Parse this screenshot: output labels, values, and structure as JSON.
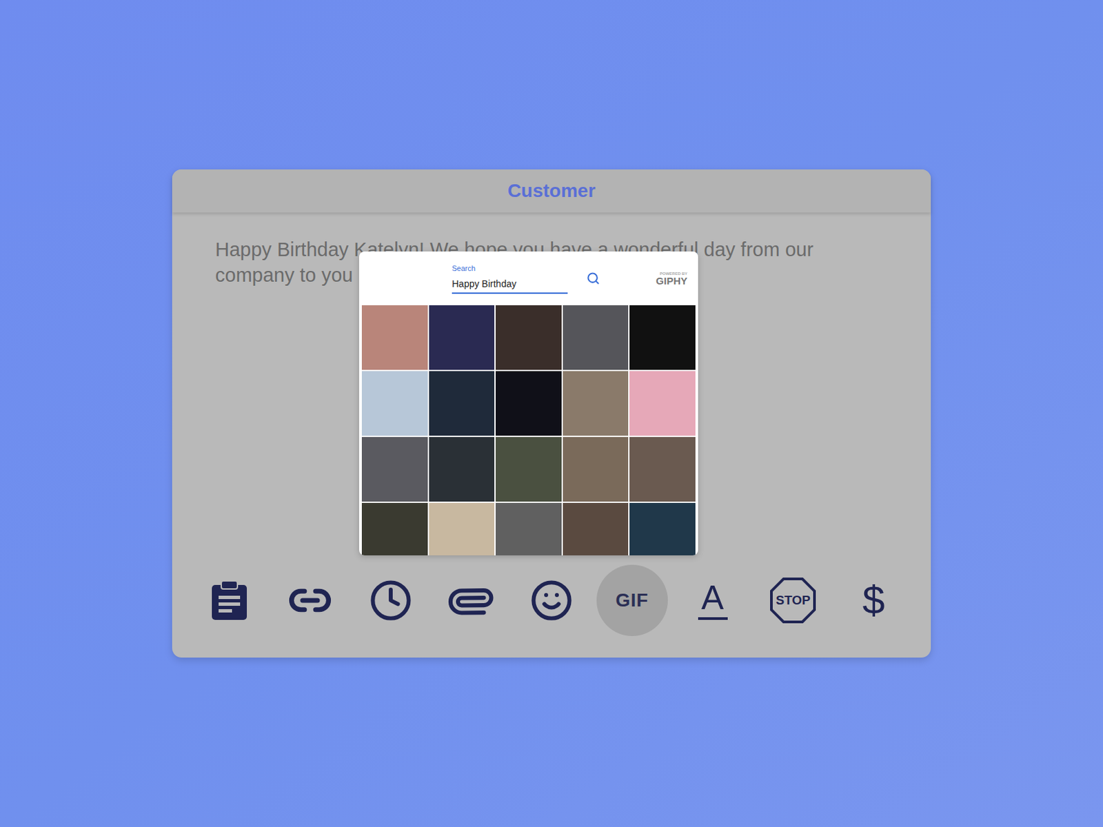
{
  "window": {
    "title": "Customer"
  },
  "message": {
    "text": "Happy Birthday Katelyn! We hope you have a wonderful day from our company to you"
  },
  "gif_picker": {
    "search_label": "Search",
    "search_value": "Happy Birthday",
    "powered_by": "POWERED BY",
    "brand": "GIPHY"
  },
  "toolbar": [
    {
      "kind": "clipboard",
      "selected": false
    },
    {
      "kind": "link",
      "selected": false
    },
    {
      "kind": "clock",
      "selected": false
    },
    {
      "kind": "paperclip",
      "selected": false
    },
    {
      "kind": "emoji",
      "selected": false
    },
    {
      "kind": "gif",
      "label": "GIF",
      "selected": true
    },
    {
      "kind": "font",
      "label": "A",
      "selected": false
    },
    {
      "kind": "stop",
      "label": "STOP",
      "selected": false
    },
    {
      "kind": "dollar",
      "label": "$",
      "selected": false
    }
  ]
}
